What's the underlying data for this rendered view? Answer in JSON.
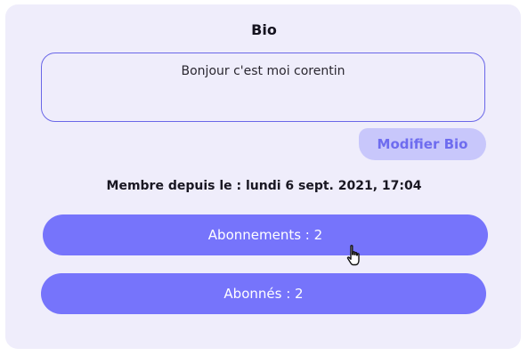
{
  "profile": {
    "title": "Bio",
    "bio_text": "Bonjour c'est moi corentin",
    "edit_bio_label": "Modifier Bio",
    "member_since": "Membre depuis le : lundi 6 sept. 2021, 17:04",
    "subscriptions_label": "Abonnements : 2",
    "followers_label": "Abonnés : 2"
  },
  "colors": {
    "card_background": "#efedfb",
    "accent": "#7674fb",
    "edit_button_background": "#c8c7fb",
    "edit_button_text": "#6e6cef"
  },
  "icons": {
    "cursor": "hand-pointer-icon"
  }
}
